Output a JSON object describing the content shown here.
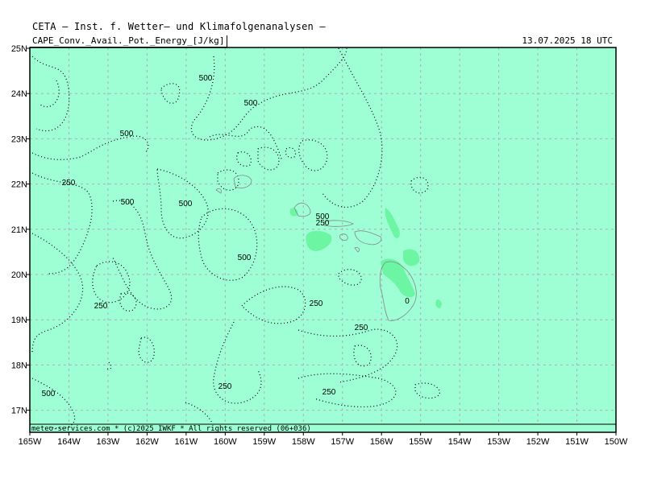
{
  "header": {
    "title": "CETA – Inst. f. Wetter– und Klimafolgenanalysen –",
    "parameter": "CAPE_Conv._Avail._Pot._Energy",
    "unit": "J/kg",
    "valid_time": "13.07.2025 18 UTC"
  },
  "footer": {
    "credit": "meteo-services.com * (c)2025 IWKF * All rights reserved (06+036)"
  },
  "axes": {
    "lat_labels": [
      "25N",
      "24N",
      "23N",
      "22N",
      "21N",
      "20N",
      "19N",
      "18N",
      "17N"
    ],
    "lon_labels": [
      "165W",
      "164W",
      "163W",
      "162W",
      "161W",
      "160W",
      "159W",
      "158W",
      "157W",
      "156W",
      "155W",
      "154W",
      "153W",
      "152W",
      "151W",
      "150W"
    ]
  },
  "contour_labels": [
    "500",
    "500",
    "500",
    "250",
    "500",
    "500",
    "500",
    "250",
    "500",
    "250",
    "250",
    "250",
    "0",
    "250",
    "500",
    "250"
  ],
  "colors": {
    "background_fill": "#9dffd3",
    "high_cape_fill": "#6cf5a2",
    "grid": "#b0b0b0",
    "contour": "#000000",
    "coast": "#888888"
  }
}
